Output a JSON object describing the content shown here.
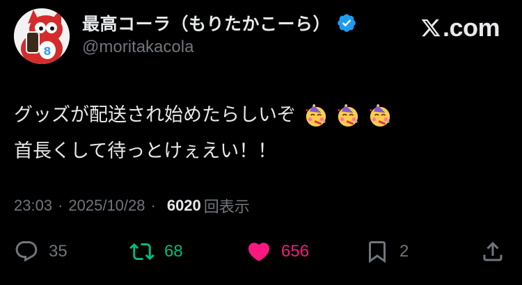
{
  "author": {
    "display_name": "最高コーラ（もりたかこーら）",
    "handle": "@moritakacola",
    "verified": true,
    "avatar_badge": "8"
  },
  "brand": {
    "label": "𝕏.com",
    "text": ".com",
    "icon": "x-logo-icon"
  },
  "tweet": {
    "line1": "グッズが配送され始めたらしいぞ",
    "line2": "首長くして待っとけぇえい！！",
    "emoji": [
      "partying-face-emoji",
      "partying-face-emoji",
      "partying-face-emoji"
    ]
  },
  "meta": {
    "time": "23:03",
    "separator1": "·",
    "date": "2025/10/28",
    "separator2": "·",
    "views": "6020",
    "views_label": "回表示"
  },
  "actions": {
    "reply": {
      "icon": "reply-icon",
      "count": "35"
    },
    "retweet": {
      "icon": "retweet-icon",
      "count": "68"
    },
    "like": {
      "icon": "heart-icon",
      "count": "656"
    },
    "bookmark": {
      "icon": "bookmark-icon",
      "count": "2"
    },
    "share": {
      "icon": "share-icon"
    }
  },
  "colors": {
    "background": "#000000",
    "text": "#e7e9ea",
    "muted": "#71767b",
    "verified": "#1d9bf0",
    "retweet": "#00ba7c",
    "like": "#f91880"
  }
}
